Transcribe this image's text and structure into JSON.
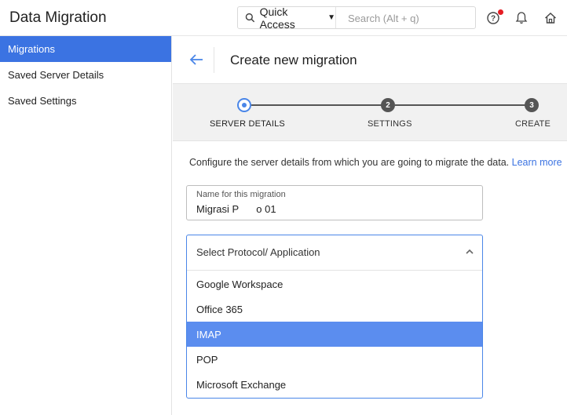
{
  "app": {
    "title": "Data Migration"
  },
  "topbar": {
    "quick_access_label": "Quick Access",
    "search_placeholder": "Search (Alt + q)",
    "icons": [
      "search-icon",
      "help-icon",
      "bell-icon",
      "home-icon"
    ],
    "notification_dot_color": "#e51c23"
  },
  "sidebar": {
    "items": [
      {
        "label": "Migrations",
        "active": true
      },
      {
        "label": "Saved Server Details",
        "active": false
      },
      {
        "label": "Saved Settings",
        "active": false
      }
    ]
  },
  "main": {
    "title": "Create new migration",
    "steps": [
      {
        "number": "1",
        "label": "SERVER DETAILS",
        "state": "current"
      },
      {
        "number": "2",
        "label": "SETTINGS",
        "state": "pending"
      },
      {
        "number": "3",
        "label": "CREATE",
        "state": "pending"
      }
    ],
    "info_text": "Configure the server details from which you are going to migrate the data.",
    "learn_more": "Learn more",
    "name_field": {
      "label": "Name for this migration",
      "value": "Migrasi P   o 01"
    },
    "protocol_select": {
      "placeholder": "Select Protocol/ Application",
      "options": [
        "Google Workspace",
        "Office 365",
        "IMAP",
        "POP",
        "Microsoft Exchange"
      ],
      "highlighted": "IMAP"
    }
  },
  "colors": {
    "accent": "#3b73e2",
    "highlight": "#5b8def",
    "stepper_bg": "#f1f1f1"
  }
}
